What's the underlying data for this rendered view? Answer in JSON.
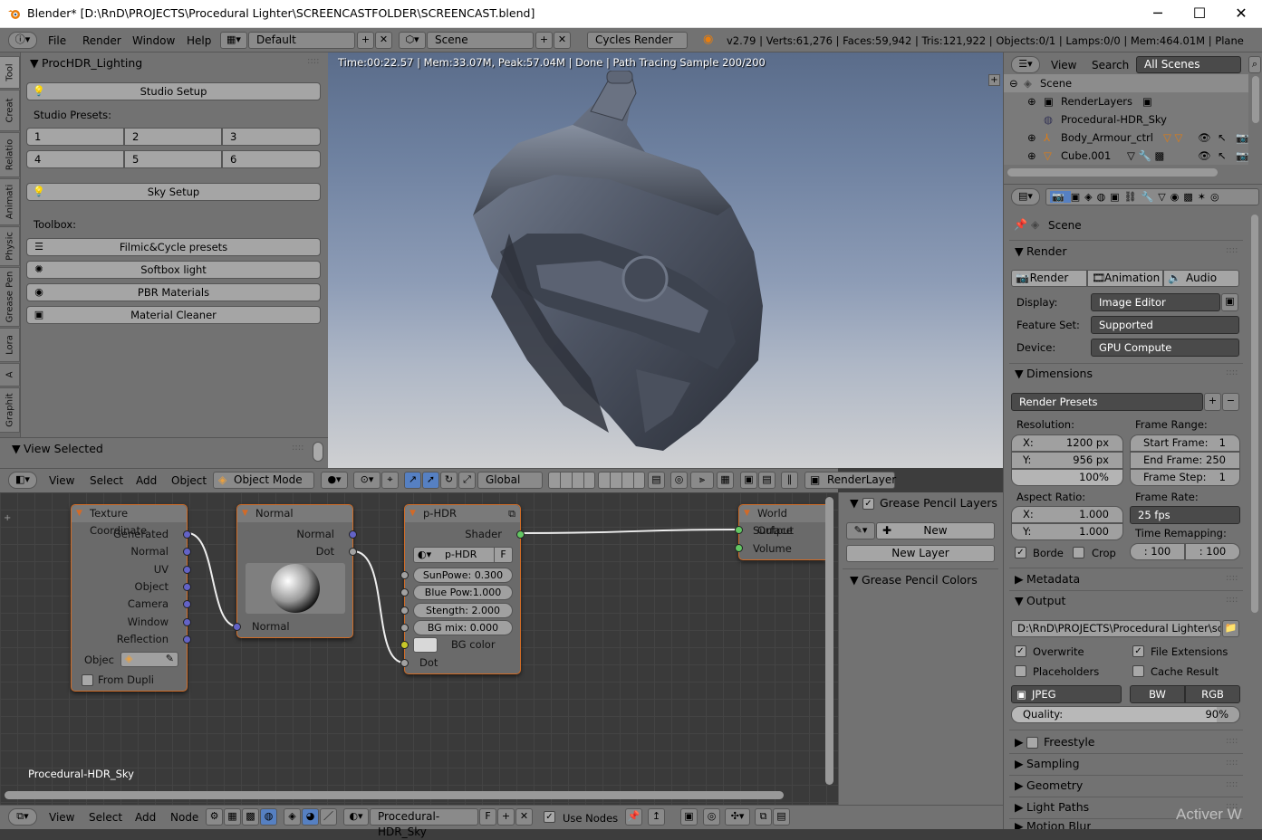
{
  "window": {
    "title": "Blender* [D:\\RnD\\PROJECTS\\Procedural Lighter\\SCREENCASTFOLDER\\SCREENCAST.blend]",
    "minimize": "─",
    "maximize": "☐",
    "close": "✕"
  },
  "infobar": {
    "menus": [
      "File",
      "Render",
      "Window",
      "Help"
    ],
    "layout": "Default",
    "scene": "Scene",
    "engine": "Cycles Render",
    "stats": "v2.79 | Verts:61,276 | Faces:59,942 | Tris:121,922 | Objects:0/1 | Lamps:0/0 | Mem:464.01M | Plane"
  },
  "tabs": [
    "Tool",
    "Creat",
    "Relatio",
    "Animati",
    "Physic",
    "Grease Pen",
    "Lora",
    "A",
    "Graphit"
  ],
  "toolshelf": {
    "panel_title": "ProcHDR_Lighting",
    "studio_setup": "Studio Setup",
    "studio_presets_label": "Studio Presets:",
    "presets": [
      "1",
      "2",
      "3",
      "4",
      "5",
      "6"
    ],
    "sky_setup": "Sky Setup",
    "toolbox_label": "Toolbox:",
    "tools": [
      "Filmic&Cycle presets",
      "Softbox light",
      "PBR Materials",
      "Material Cleaner"
    ],
    "view_selected": "View Selected"
  },
  "viewport": {
    "render_info": "Time:00:22.57 | Mem:33.07M, Peak:57.04M | Done | Path Tracing Sample 200/200"
  },
  "header3d": {
    "menus": [
      "View",
      "Select",
      "Add",
      "Object"
    ],
    "mode": "Object Mode",
    "orientation": "Global",
    "render_layer": "RenderLayer"
  },
  "nodes": {
    "texcoord": {
      "title": "Texture Coordinate",
      "outputs": [
        "Generated",
        "Normal",
        "UV",
        "Object",
        "Camera",
        "Window",
        "Reflection"
      ],
      "object_label": "Objec",
      "from_dupli": "From Dupli"
    },
    "normal": {
      "title": "Normal",
      "outputs": [
        "Normal",
        "Dot"
      ],
      "input": "Normal"
    },
    "phdr": {
      "title": "p-HDR",
      "output": "Shader",
      "group_name": "p-HDR",
      "group_flag": "F",
      "sun_label": "SunPowe:",
      "sun_value": "0.300",
      "blue_label": "Blue Pow:",
      "blue_value": "1.000",
      "strength_label": "Stength:",
      "strength_value": "2.000",
      "bgmix_label": "BG mix:",
      "bgmix_value": "0.000",
      "bg_color": "BG color",
      "dot": "Dot"
    },
    "world": {
      "title": "World Output",
      "inputs": [
        "Surface",
        "Volume"
      ]
    },
    "tree_name": "Procedural-HDR_Sky"
  },
  "grease": {
    "layers_title": "Grease Pencil Layers",
    "new": "New",
    "new_layer": "New Layer",
    "colors_title": "Grease Pencil Colors"
  },
  "nodeheader": {
    "menus": [
      "View",
      "Select",
      "Add",
      "Node"
    ],
    "tree": "Procedural-HDR_Sky",
    "flag": "F",
    "use_nodes": "Use Nodes"
  },
  "outliner": {
    "menus": [
      "View",
      "Search"
    ],
    "filter": "All Scenes",
    "rows": [
      "Scene",
      "RenderLayers",
      "Procedural-HDR_Sky",
      "Body_Armour_ctrl",
      "Cube.001"
    ]
  },
  "props": {
    "scene_label": "Scene",
    "render_title": "Render",
    "render_buttons": [
      "Render",
      "Animation",
      "Audio"
    ],
    "display_label": "Display:",
    "display_value": "Image Editor",
    "feature_label": "Feature Set:",
    "feature_value": "Supported",
    "device_label": "Device:",
    "device_value": "GPU Compute",
    "dimensions_title": "Dimensions",
    "render_presets": "Render Presets",
    "resolution_label": "Resolution:",
    "res_x_label": "X:",
    "res_x": "1200 px",
    "res_y_label": "Y:",
    "res_y": "956 px",
    "res_pct": "100%",
    "frame_range_label": "Frame Range:",
    "start_label": "Start Frame:",
    "start": "1",
    "end_label": "End Frame:",
    "end": "250",
    "step_label": "Frame Step:",
    "step": "1",
    "aspect_label": "Aspect Ratio:",
    "asp_x_label": "X:",
    "asp_x": "1.000",
    "asp_y_label": "Y:",
    "asp_y": "1.000",
    "frame_rate_label": "Frame Rate:",
    "frame_rate": "25 fps",
    "remap_label": "Time Remapping:",
    "remap_old": ": 100",
    "remap_new": ": 100",
    "border": "Borde",
    "crop": "Crop",
    "metadata_title": "Metadata",
    "output_title": "Output",
    "output_path": "D:\\RnD\\PROJECTS\\Procedural Lighter\\scree...",
    "overwrite": "Overwrite",
    "file_ext": "File Extensions",
    "placeholders": "Placeholders",
    "cache_result": "Cache Result",
    "format": "JPEG",
    "bw": "BW",
    "rgb": "RGB",
    "quality_label": "Quality:",
    "quality": "90%",
    "freestyle_title": "Freestyle",
    "sampling_title": "Sampling",
    "geometry_title": "Geometry",
    "lightpaths_title": "Light Paths",
    "motionblur_title": "Motion Blur"
  },
  "watermark": "Activer W"
}
